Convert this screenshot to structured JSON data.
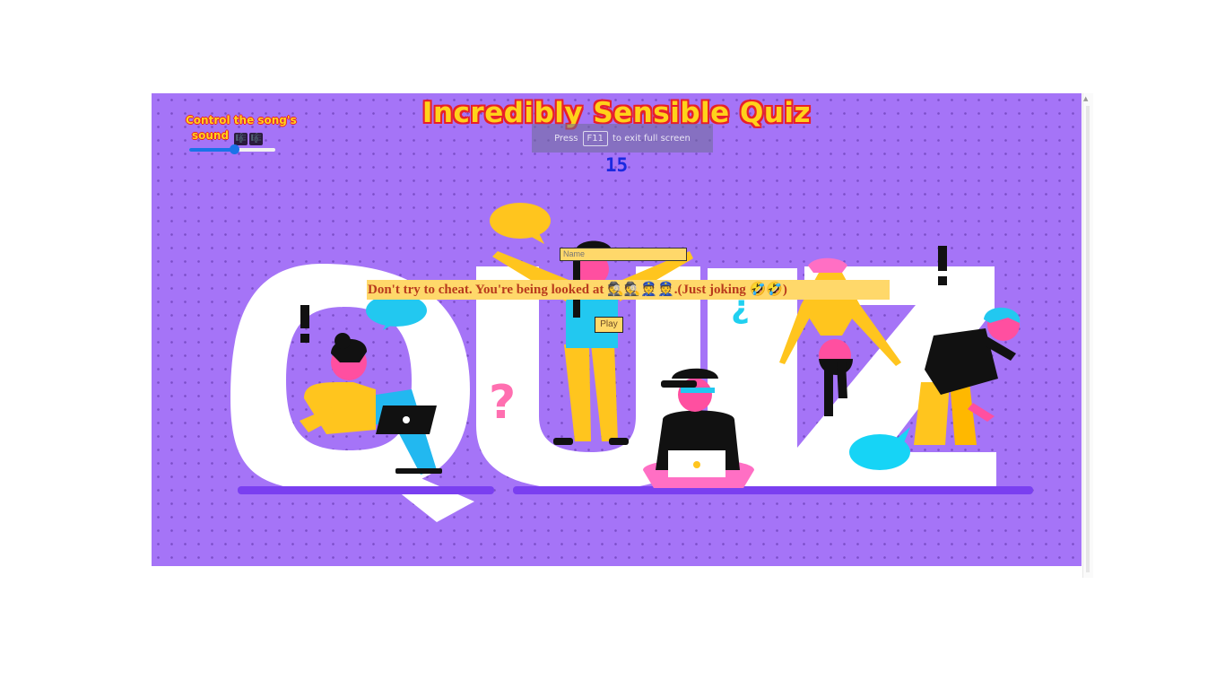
{
  "header": {
    "title": "Incredibly Sensible Quiz"
  },
  "sound_control": {
    "label_line1": "Control the song's",
    "label_line2": "sound",
    "note_icons": [
      "🎼",
      "🎼"
    ],
    "volume": 0.52
  },
  "fullscreen_notice": {
    "press": "Press",
    "key": "F11",
    "suffix": "to exit full screen"
  },
  "timer": {
    "value": "15"
  },
  "form": {
    "name_placeholder": "Name",
    "warning": "Don't try to cheat. You're being looked at 🕵🕵👮👮.(Just joking 🤣🤣)",
    "play_label": "Play"
  },
  "illustration": {
    "word": "QUIZ",
    "symbols": [
      "!",
      "?",
      "¿",
      "!"
    ]
  },
  "colors": {
    "background": "#a574f7",
    "title_fill": "#ffd21a",
    "title_outline": "#e8202a",
    "timer": "#1a29e0",
    "input_fill": "#ffd86a",
    "warning_text": "#b83a1c"
  }
}
